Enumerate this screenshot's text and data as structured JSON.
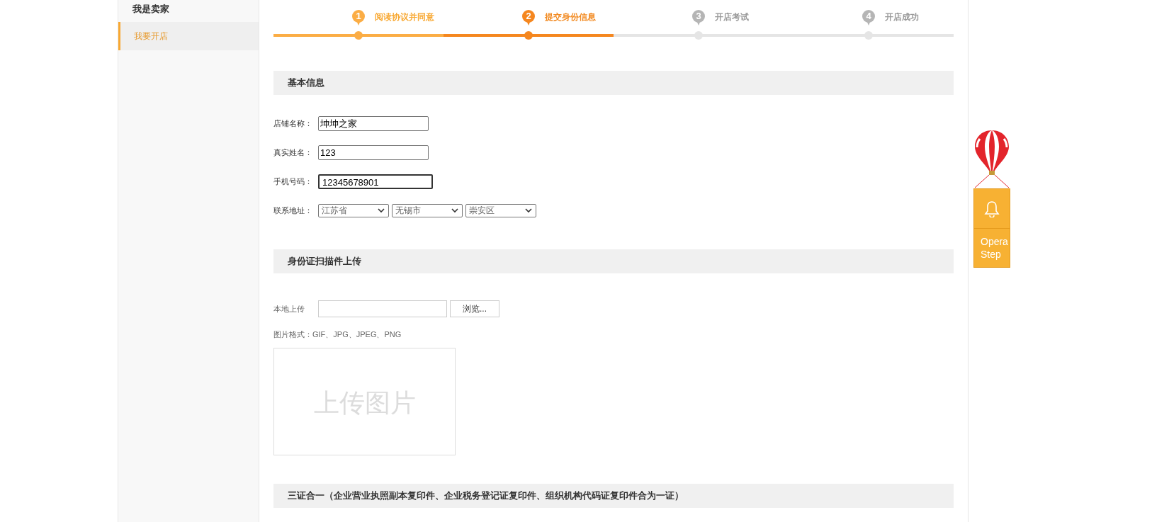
{
  "sidebar": {
    "title": "我是卖家",
    "items": [
      {
        "label": "我要开店",
        "selected": true
      }
    ]
  },
  "steps": [
    {
      "number": "1",
      "label": "阅读协议并同意",
      "completed": true,
      "selected": false
    },
    {
      "number": "2",
      "label": "提交身份信息",
      "completed": false,
      "selected": true
    },
    {
      "number": "3",
      "label": "开店考试",
      "completed": false,
      "selected": false
    },
    {
      "number": "4",
      "label": "开店成功",
      "completed": false,
      "selected": false
    }
  ],
  "basic_info": {
    "title": "基本信息",
    "fields": [
      {
        "kind": "text",
        "label": "店铺名称：",
        "value": "坤坤之家",
        "focused": false
      },
      {
        "kind": "text",
        "label": "真实姓名：",
        "value": "123",
        "focused": false
      },
      {
        "kind": "text",
        "label": "手机号码：",
        "value": "12345678901",
        "focused": true
      },
      {
        "kind": "selects",
        "label": "联系地址：",
        "values": [
          "江苏省",
          "无锡市",
          "崇安区"
        ]
      }
    ]
  },
  "id_upload": {
    "title": "身份证扫描件上传",
    "upload_label": "本地上传",
    "browse_button": "浏览...",
    "format_note": "图片格式：GIF、JPG、JPEG、PNG",
    "preview_placeholder": "上传图片"
  },
  "license_section": {
    "title": "三证合一（企业营业执照副本复印件、企业税务登记证复印件、组织机构代码证复印件合为一证）"
  },
  "float_widget": {
    "label_lines": [
      "Opera",
      "Step"
    ]
  }
}
